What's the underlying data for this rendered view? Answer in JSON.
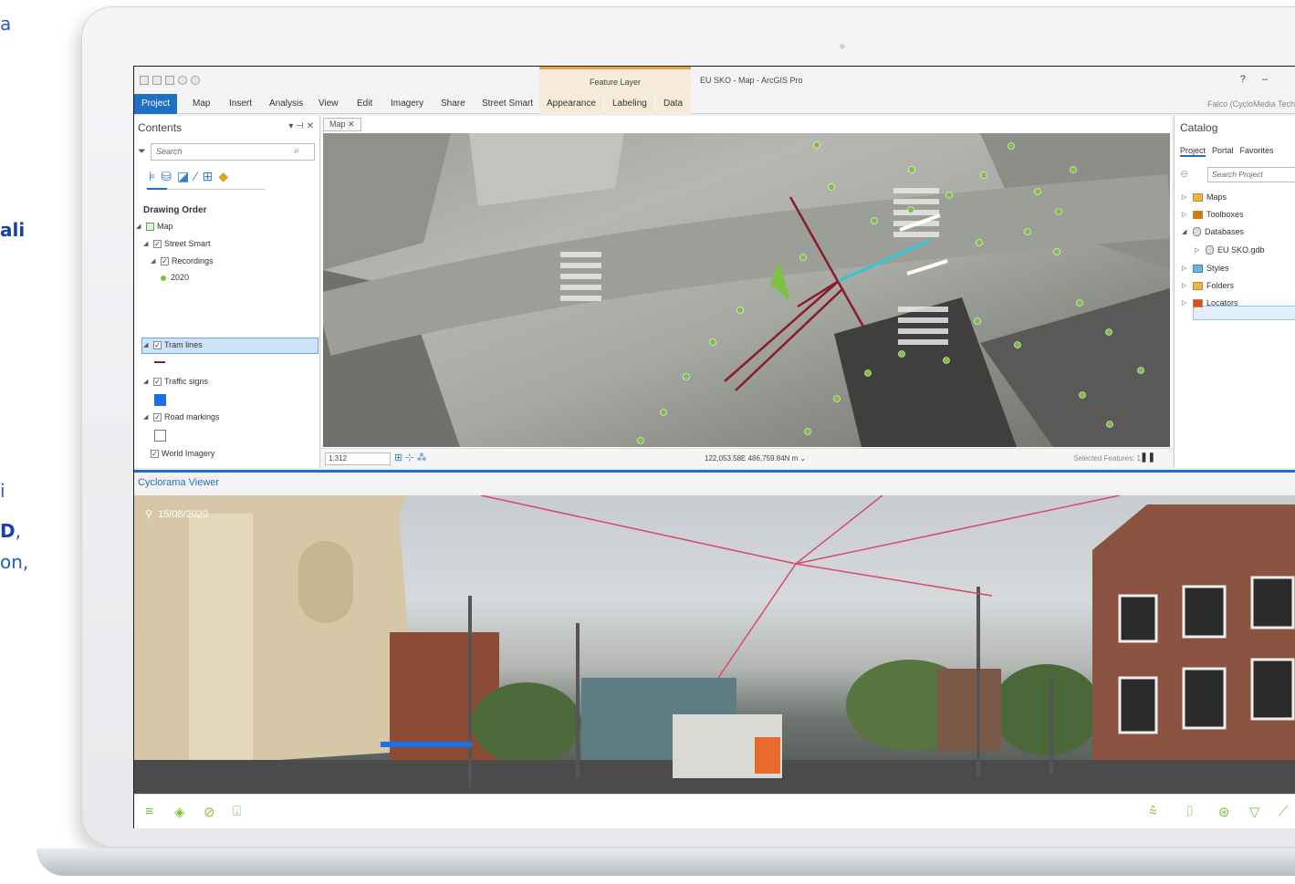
{
  "background_text": {
    "frag_a": "a",
    "frag_ali": "ali",
    "frag_i": "i",
    "frag_d": "D",
    "frag_comma": ",",
    "frag_on": "on,"
  },
  "window": {
    "title": "EU SKO - Map - ArcGIS Pro",
    "contextual_tab_group": "Feature Layer",
    "help": "?",
    "user": "Falco (CycloMedia Tech"
  },
  "ribbon": {
    "tabs": [
      "Project",
      "Map",
      "Insert",
      "Analysis",
      "View",
      "Edit",
      "Imagery",
      "Share",
      "Street Smart",
      "Appearance",
      "Labeling",
      "Data"
    ],
    "active_tab": "Project"
  },
  "contents": {
    "title": "Contents",
    "search_placeholder": "Search",
    "drawing_order": "Drawing Order",
    "layers": {
      "map": "Map",
      "street_smart": "Street Smart",
      "recordings": "Recordings",
      "year": "2020",
      "tram_lines": "Tram lines",
      "traffic_signs": "Traffic signs",
      "road_markings": "Road markings",
      "world_imagery": "World Imagery"
    }
  },
  "map": {
    "tab_label": "Map",
    "scale": "1:312",
    "coordinates": "122,053.58E 486,759.84N m",
    "selected_features": "Selected Features: 1"
  },
  "catalog": {
    "title": "Catalog",
    "tabs": [
      "Project",
      "Portal",
      "Favorites"
    ],
    "search_placeholder": "Search Project",
    "items": {
      "maps": "Maps",
      "toolboxes": "Toolboxes",
      "databases": "Databases",
      "gdb": "EU SKO.gdb",
      "styles": "Styles",
      "folders": "Folders",
      "locators": "Locators"
    }
  },
  "cyclorama": {
    "title": "Cyclorama Viewer",
    "date": "15/08/2020"
  },
  "colors": {
    "accent": "#1f6fc4",
    "tram_line": "#8b1a2b",
    "selection": "#2fc7d6",
    "recording_point": "#7cc142",
    "toolbar_icon": "#7cc142"
  }
}
